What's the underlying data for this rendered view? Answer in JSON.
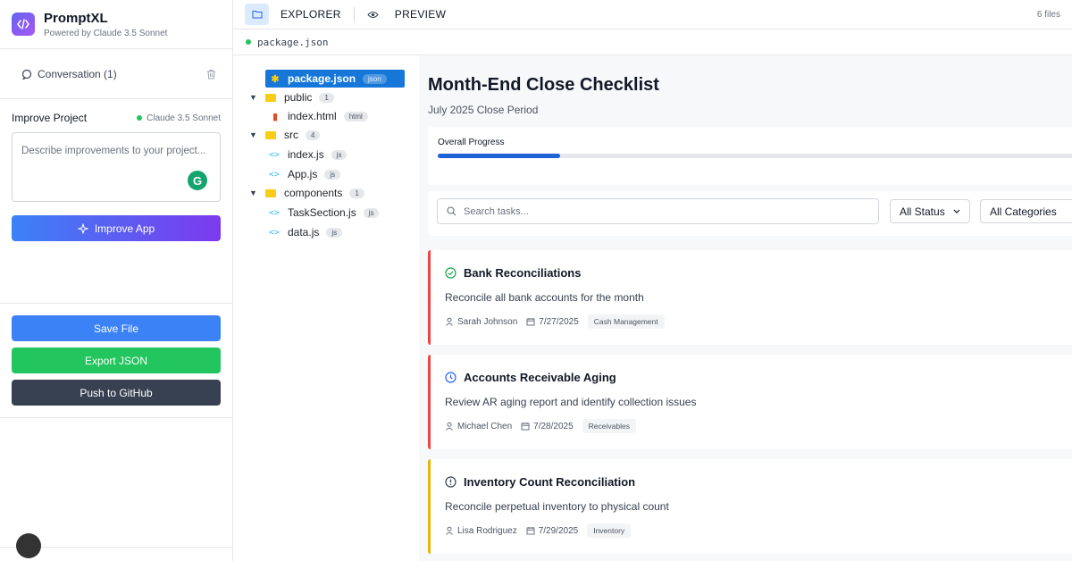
{
  "app": {
    "name": "PromptXL",
    "subtitle": "Powered by Claude 3.5 Sonnet"
  },
  "sidebar": {
    "conversation_label": "Conversation (1)",
    "improve_title": "Improve Project",
    "model_name": "Claude 3.5 Sonnet",
    "textarea_placeholder": "Describe improvements to your project...",
    "improve_button": "Improve App",
    "save_button": "Save File",
    "export_button": "Export JSON",
    "push_button": "Push to GitHub"
  },
  "topbar": {
    "explorer_tab": "EXPLORER",
    "preview_tab": "PREVIEW",
    "files_count": "6 files",
    "active_file": "package.json"
  },
  "tree": [
    {
      "name": "package.json",
      "badge": "json",
      "type": "file",
      "icon": "gear-icon",
      "selected": true
    },
    {
      "name": "public",
      "badge": "1",
      "type": "folder"
    },
    {
      "name": "index.html",
      "badge": "html",
      "type": "file",
      "icon": "html-file-icon"
    },
    {
      "name": "src",
      "badge": "4",
      "type": "folder"
    },
    {
      "name": "index.js",
      "badge": "js",
      "type": "file",
      "icon": "code-icon"
    },
    {
      "name": "App.js",
      "badge": "js",
      "type": "file",
      "icon": "code-icon"
    },
    {
      "name": "components",
      "badge": "1",
      "type": "folder"
    },
    {
      "name": "TaskSection.js",
      "badge": "js",
      "type": "file",
      "icon": "code-icon"
    },
    {
      "name": "data.js",
      "badge": "js",
      "type": "file",
      "icon": "code-icon"
    }
  ],
  "preview": {
    "title": "Month-End Close Checklist",
    "subtitle": "July 2025 Close Period",
    "progress_label": "Overall Progress",
    "progress_fraction": 0.19,
    "search_placeholder": "Search tasks...",
    "status_filter": "All Status",
    "category_filter": "All Categories",
    "tasks": [
      {
        "title": "Bank Reconciliations",
        "description": "Reconcile all bank accounts for the month",
        "assignee": "Sarah Johnson",
        "date": "7/27/2025",
        "category": "Cash Management",
        "status_icon": "check-circle-icon",
        "color": "#ef4444"
      },
      {
        "title": "Accounts Receivable Aging",
        "description": "Review AR aging report and identify collection issues",
        "assignee": "Michael Chen",
        "date": "7/28/2025",
        "category": "Receivables",
        "status_icon": "clock-icon",
        "color": "#ef4444"
      },
      {
        "title": "Inventory Count Reconciliation",
        "description": "Reconcile perpetual inventory to physical count",
        "assignee": "Lisa Rodriguez",
        "date": "7/29/2025",
        "category": "Inventory",
        "status_icon": "alert-circle-icon",
        "color": "#eab308"
      }
    ]
  },
  "colors": {
    "accent": "#1677d9",
    "save": "#3b82f6",
    "export": "#22c55e",
    "push": "#374151"
  }
}
